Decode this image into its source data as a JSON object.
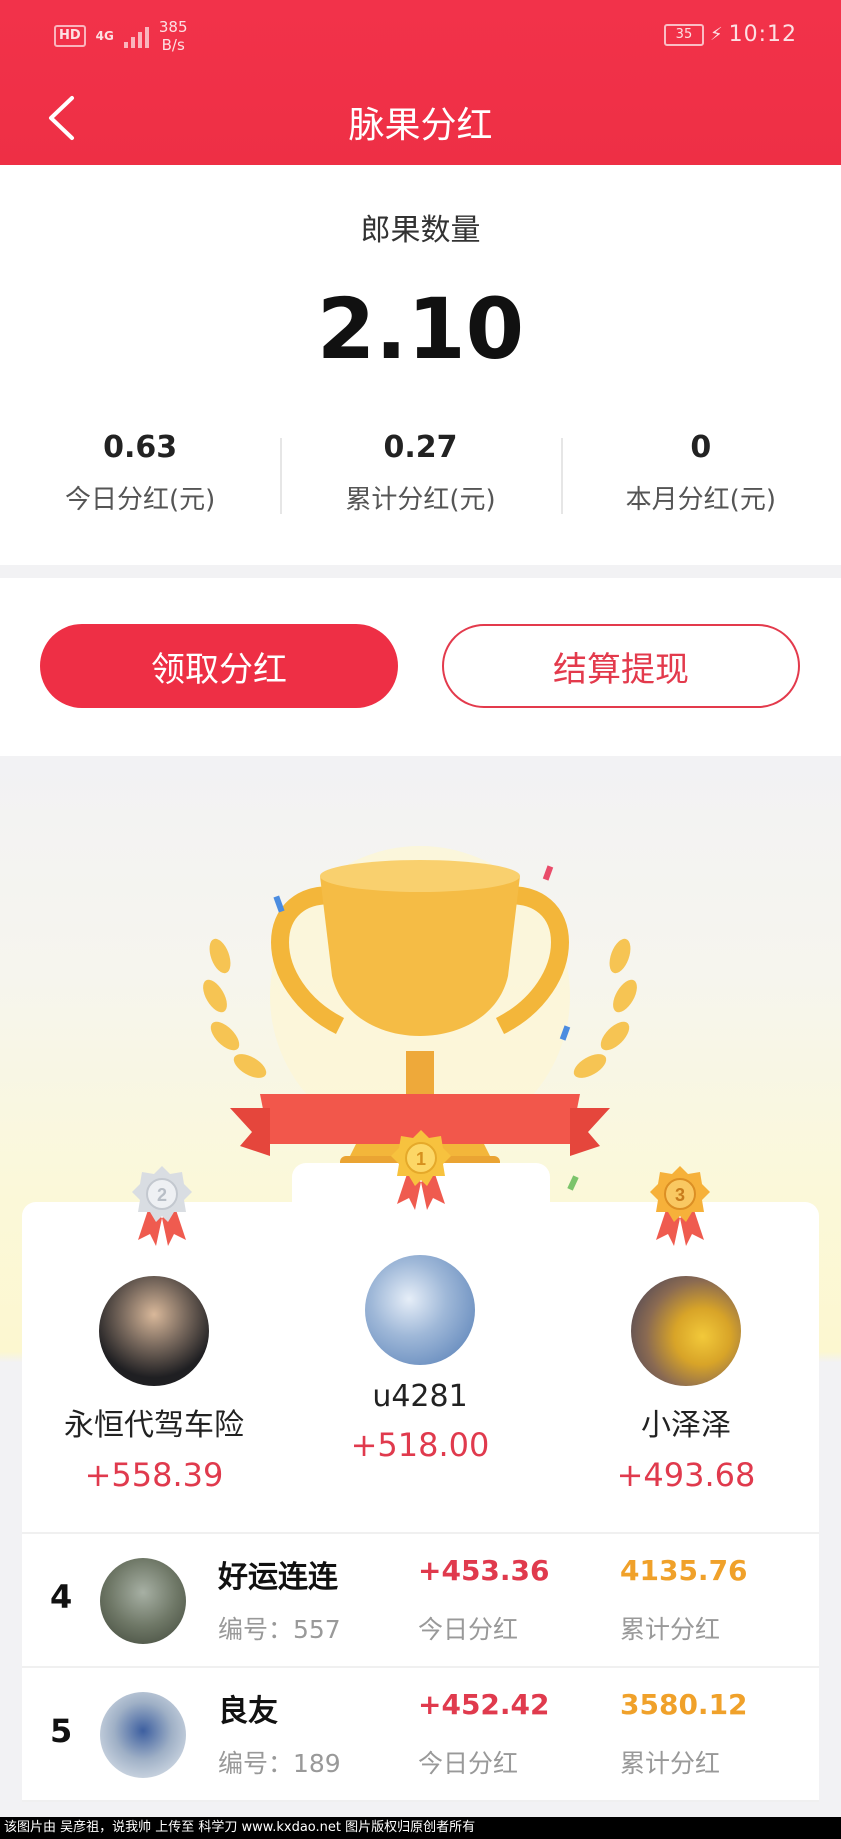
{
  "status_bar": {
    "hd": "HD",
    "network": "4G",
    "speed_value": "385",
    "speed_unit": "B/s",
    "battery": "35",
    "time": "10:12"
  },
  "header": {
    "title": "脉果分红"
  },
  "summary": {
    "count_label": "郎果数量",
    "count_value": "2.10",
    "stats": [
      {
        "value": "0.63",
        "label": "今日分红(元)"
      },
      {
        "value": "0.27",
        "label": "累计分红(元)"
      },
      {
        "value": "0",
        "label": "本月分红(元)"
      }
    ]
  },
  "actions": {
    "claim_label": "领取分红",
    "withdraw_label": "结算提现"
  },
  "colors": {
    "brand_red": "#ee2f45",
    "gold": "#f0a12a"
  },
  "top3": [
    {
      "rank": "1",
      "name": "u4281",
      "amount": "+518.00"
    },
    {
      "rank": "2",
      "name": "永恒代驾车险",
      "amount": "+558.39"
    },
    {
      "rank": "3",
      "name": "小泽泽",
      "amount": "+493.68"
    }
  ],
  "list": [
    {
      "rank": "4",
      "name": "好运连连",
      "id_text": "编号：557",
      "today": "+453.36",
      "today_label": "今日分红",
      "total": "4135.76",
      "total_label": "累计分红"
    },
    {
      "rank": "5",
      "name": "良友",
      "id_text": "编号：189",
      "today": "+452.42",
      "today_label": "今日分红",
      "total": "3580.12",
      "total_label": "累计分红"
    }
  ],
  "watermark": "该图片由 吴彦祖，说我帅 上传至 科学刀 www.kxdao.net 图片版权归原创者所有"
}
